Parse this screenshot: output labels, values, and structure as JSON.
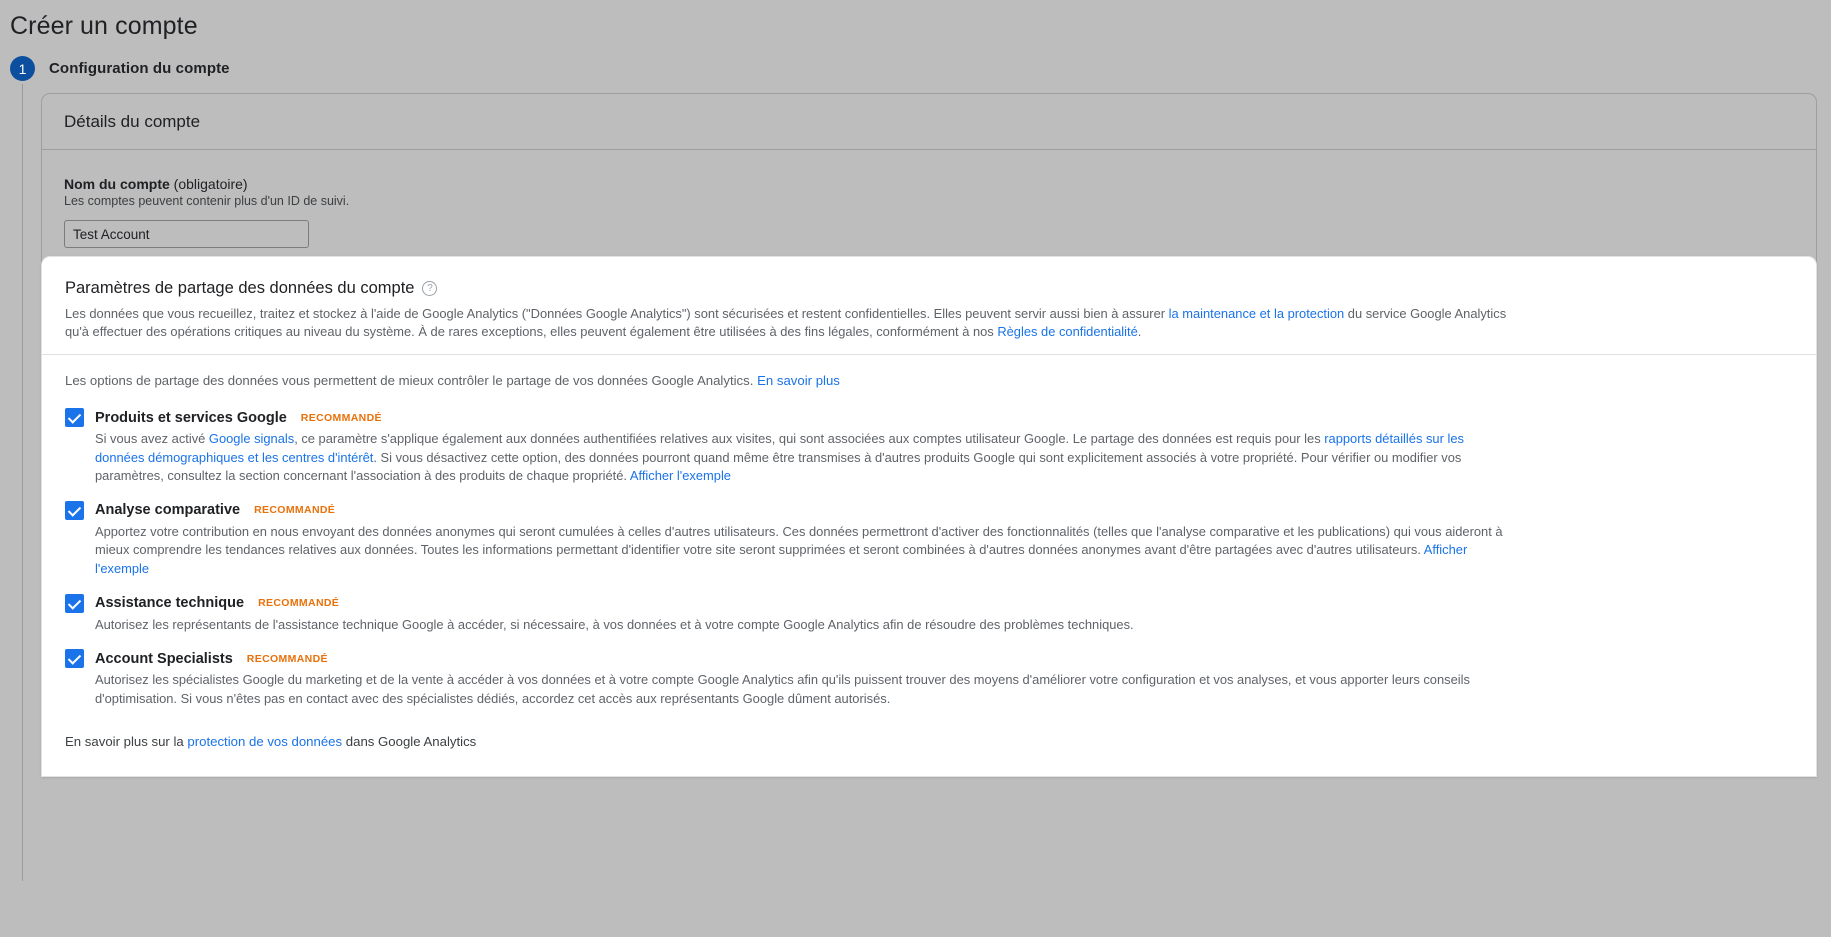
{
  "header": {
    "title": "Créer un compte"
  },
  "step": {
    "number": "1",
    "label": "Configuration du compte"
  },
  "account_details": {
    "card_title": "Détails du compte",
    "field_label_bold": "Nom du compte",
    "field_label_rest": " (obligatoire)",
    "field_hint": "Les comptes peuvent contenir plus d'un ID de suivi.",
    "input_value": "Test Account",
    "input_placeholder": ""
  },
  "sharing": {
    "title": "Paramètres de partage des données du compte",
    "help_icon": "?",
    "intro_paragraph": {
      "p1": "Les données que vous recueillez, traitez et stockez à l'aide de Google Analytics (\"Données Google Analytics\") sont sécurisées et restent confidentielles. Elles peuvent servir aussi bien à assurer ",
      "link1": "la maintenance et la protection",
      "p2": " du service Google Analytics qu'à effectuer des opérations critiques au niveau du système. À de rares exceptions, elles peuvent également être utilisées à des fins légales, conformément à nos ",
      "link2": "Règles de confidentialité",
      "p3": "."
    },
    "options_intro": {
      "text": "Les options de partage des données vous permettent de mieux contrôler le partage de vos données Google Analytics. ",
      "link": "En savoir plus"
    },
    "badge_recommended": "RECOMMANDÉ",
    "options": [
      {
        "title": "Produits et services Google",
        "checked": true,
        "desc_parts": [
          {
            "type": "text",
            "value": "Si vous avez activé "
          },
          {
            "type": "link",
            "value": "Google signals"
          },
          {
            "type": "text",
            "value": ", ce paramètre s'applique également aux données authentifiées relatives aux visites, qui sont associées aux comptes utilisateur Google. Le partage des données est requis pour les "
          },
          {
            "type": "link",
            "value": "rapports détaillés sur les données démographiques et les centres d'intérêt"
          },
          {
            "type": "text",
            "value": ". Si vous désactivez cette option, des données pourront quand même être transmises à d'autres produits Google qui sont explicitement associés à votre propriété. Pour vérifier ou modifier vos paramètres, consultez la section concernant l'association à des produits de chaque propriété. "
          },
          {
            "type": "link",
            "value": "Afficher l'exemple"
          }
        ]
      },
      {
        "title": "Analyse comparative",
        "checked": true,
        "desc_parts": [
          {
            "type": "text",
            "value": "Apportez votre contribution en nous envoyant des données anonymes qui seront cumulées à celles d'autres utilisateurs. Ces données permettront d'activer des fonctionnalités (telles que l'analyse comparative et les publications) qui vous aideront à mieux comprendre les tendances relatives aux données. Toutes les informations permettant d'identifier votre site seront supprimées et seront combinées à d'autres données anonymes avant d'être partagées avec d'autres utilisateurs. "
          },
          {
            "type": "link",
            "value": "Afficher l'exemple"
          }
        ]
      },
      {
        "title": "Assistance technique",
        "checked": true,
        "desc_parts": [
          {
            "type": "text",
            "value": "Autorisez les représentants de l'assistance technique Google à accéder, si nécessaire, à vos données et à votre compte Google Analytics afin de résoudre des problèmes techniques."
          }
        ]
      },
      {
        "title": "Account Specialists",
        "checked": true,
        "desc_parts": [
          {
            "type": "text",
            "value": "Autorisez les spécialistes Google du marketing et de la vente à accéder à vos données et à votre compte Google Analytics afin qu'ils puissent trouver des moyens d'améliorer votre configuration et vos analyses, et vous apporter leurs conseils d'optimisation. Si vous n'êtes pas en contact avec des spécialistes dédiés, accordez cet accès aux représentants Google dûment autorisés."
          }
        ]
      }
    ],
    "footer_note": {
      "before": "En savoir plus sur la ",
      "link": "protection de vos données",
      "after": " dans Google Analytics"
    }
  },
  "colors": {
    "page_background": "#bdbdbd",
    "accent_blue": "#1a73e8",
    "step_badge_blue": "#0b4f9e",
    "recommended_orange": "#e8710a",
    "card_white": "#ffffff",
    "body_text": "#5f6368"
  }
}
